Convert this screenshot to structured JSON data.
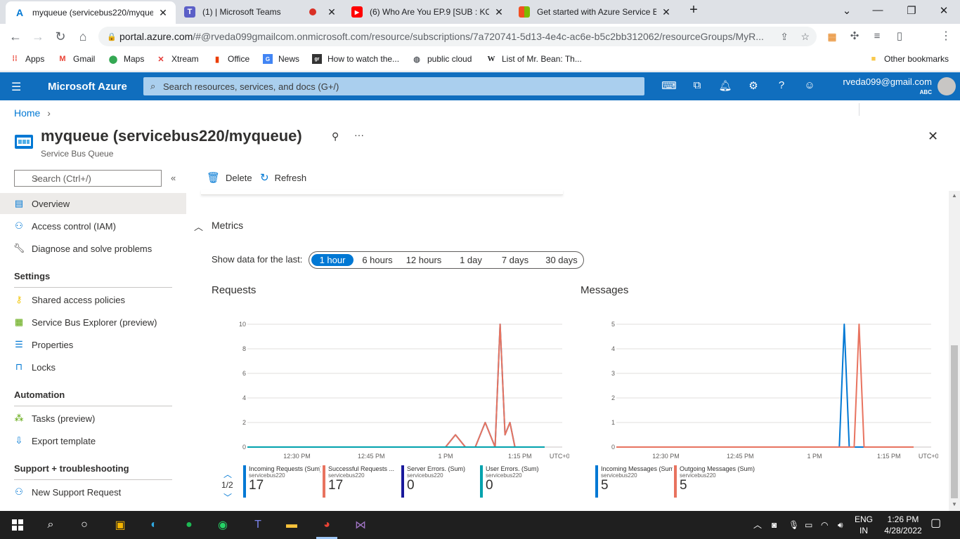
{
  "browser": {
    "tabs": [
      {
        "title": "myqueue (servicebus220/myque",
        "icon": "azure-icon",
        "active": true
      },
      {
        "title": "(1) | Microsoft Teams",
        "icon": "teams-icon",
        "active": false
      },
      {
        "title": "(6) Who Are You EP.9 [SUB : KOR,",
        "icon": "youtube-icon",
        "active": false
      },
      {
        "title": "Get started with Azure Service Bu",
        "icon": "microsoft-icon",
        "active": false
      }
    ],
    "url_host": "portal.azure.com",
    "url_rest": "/#@rveda099gmailcom.onmicrosoft.com/resource/subscriptions/7a720741-5d13-4e4c-ac6e-b5c2bb312062/resourceGroups/MyR...",
    "profile_initial": "V",
    "bookmarks": [
      {
        "label": "Apps",
        "icon": "apps-grid-icon"
      },
      {
        "label": "Gmail",
        "icon": "gmail-icon"
      },
      {
        "label": "Maps",
        "icon": "maps-icon"
      },
      {
        "label": "Xtream",
        "icon": "xtream-icon"
      },
      {
        "label": "Office",
        "icon": "office-icon"
      },
      {
        "label": "News",
        "icon": "news-icon"
      },
      {
        "label": "How to watch the...",
        "icon": "site-icon"
      },
      {
        "label": "public cloud",
        "icon": "globe-icon"
      },
      {
        "label": "List of Mr. Bean: Th...",
        "icon": "wikipedia-icon"
      }
    ],
    "other_bookmarks": "Other bookmarks"
  },
  "azure": {
    "brand": "Microsoft Azure",
    "search_placeholder": "Search resources, services, and docs (G+/)",
    "user_email": "rveda099@gmail.com",
    "user_org": "ABC",
    "accent": "#0078d4"
  },
  "page": {
    "breadcrumb_home": "Home",
    "title": "myqueue (servicebus220/myqueue)",
    "subtitle": "Service Bus Queue",
    "side_search_placeholder": "Search (Ctrl+/)",
    "nav": [
      {
        "label": "Overview",
        "icon": "overview-icon",
        "selected": true
      },
      {
        "label": "Access control (IAM)",
        "icon": "iam-people-icon"
      },
      {
        "label": "Diagnose and solve problems",
        "icon": "wrench-icon"
      }
    ],
    "sections": [
      {
        "title": "Settings",
        "items": [
          {
            "label": "Shared access policies",
            "icon": "key-icon"
          },
          {
            "label": "Service Bus Explorer (preview)",
            "icon": "grid-icon"
          },
          {
            "label": "Properties",
            "icon": "properties-icon"
          },
          {
            "label": "Locks",
            "icon": "lock-icon"
          }
        ]
      },
      {
        "title": "Automation",
        "items": [
          {
            "label": "Tasks (preview)",
            "icon": "tasks-icon"
          },
          {
            "label": "Export template",
            "icon": "export-icon"
          }
        ]
      },
      {
        "title": "Support + troubleshooting",
        "items": [
          {
            "label": "New Support Request",
            "icon": "support-icon"
          }
        ]
      }
    ],
    "commands": {
      "delete": "Delete",
      "refresh": "Refresh"
    },
    "metrics_header": "Metrics",
    "show_data_label": "Show data for the last:",
    "time_ranges": [
      "1 hour",
      "6 hours",
      "12 hours",
      "1 day",
      "7 days",
      "30 days"
    ],
    "selected_range": "1 hour",
    "legend_pager": "1/2"
  },
  "chart_data": [
    {
      "type": "line",
      "title": "Requests",
      "x": [
        "12:20",
        "12:25",
        "12:30",
        "12:35",
        "12:40",
        "12:45",
        "12:50",
        "12:55",
        "13:00",
        "13:02",
        "13:04",
        "13:06",
        "13:08",
        "13:10",
        "13:11",
        "13:12",
        "13:13",
        "13:14",
        "13:15",
        "13:20"
      ],
      "x_tick_labels": [
        "12:30 PM",
        "12:45 PM",
        "1 PM",
        "1:15 PM",
        "UTC+05:30"
      ],
      "ylim": [
        0,
        10
      ],
      "y_ticks": [
        0,
        2,
        4,
        6,
        8,
        10
      ],
      "series": [
        {
          "name": "Incoming Requests (Sum)",
          "color": "#0078d4",
          "values": [
            0,
            0,
            0,
            0,
            0,
            0,
            0,
            0,
            0,
            1,
            0,
            0,
            2,
            0,
            10,
            1,
            2,
            0,
            0,
            0
          ],
          "total": "17"
        },
        {
          "name": "Successful Requests ...",
          "color": "#e8735f",
          "values": [
            0,
            0,
            0,
            0,
            0,
            0,
            0,
            0,
            0,
            1,
            0,
            0,
            2,
            0,
            10,
            1,
            2,
            0,
            0,
            0
          ],
          "total": "17"
        },
        {
          "name": "Server Errors. (Sum)",
          "color": "#1a1a9c",
          "values": [
            0,
            0,
            0,
            0,
            0,
            0,
            0,
            0,
            0,
            0,
            0,
            0,
            0,
            0,
            0,
            0,
            0,
            0,
            0,
            0
          ],
          "total": "0"
        },
        {
          "name": "User Errors. (Sum)",
          "color": "#00a2ad",
          "values": [
            0,
            0,
            0,
            0,
            0,
            0,
            0,
            0,
            0,
            0,
            0,
            0,
            0,
            0,
            0,
            0,
            0,
            0,
            0,
            0
          ],
          "total": "0"
        }
      ],
      "series_sub": "servicebus220"
    },
    {
      "type": "line",
      "title": "Messages",
      "x": [
        "12:20",
        "12:25",
        "12:30",
        "12:35",
        "12:40",
        "12:45",
        "12:50",
        "12:55",
        "13:00",
        "13:05",
        "13:06",
        "13:07",
        "13:08",
        "13:09",
        "13:10",
        "13:11",
        "13:15",
        "13:20"
      ],
      "x_tick_labels": [
        "12:30 PM",
        "12:45 PM",
        "1 PM",
        "1:15 PM",
        "UTC+05:30"
      ],
      "ylim": [
        0,
        5
      ],
      "y_ticks": [
        0,
        1,
        2,
        3,
        4,
        5
      ],
      "series": [
        {
          "name": "Incoming Messages (Sum)",
          "color": "#0078d4",
          "values": [
            0,
            0,
            0,
            0,
            0,
            0,
            0,
            0,
            0,
            0,
            5,
            0,
            0,
            0,
            0,
            0,
            0,
            0
          ],
          "total": "5"
        },
        {
          "name": "Outgoing Messages (Sum)",
          "color": "#e8735f",
          "values": [
            0,
            0,
            0,
            0,
            0,
            0,
            0,
            0,
            0,
            0,
            0,
            0,
            0,
            5,
            0,
            0,
            0,
            0
          ],
          "total": "5"
        }
      ],
      "series_sub": "servicebus220"
    }
  ],
  "taskbar": {
    "lang": "ENG",
    "region": "IN",
    "time": "1:26 PM",
    "date": "4/28/2022"
  }
}
